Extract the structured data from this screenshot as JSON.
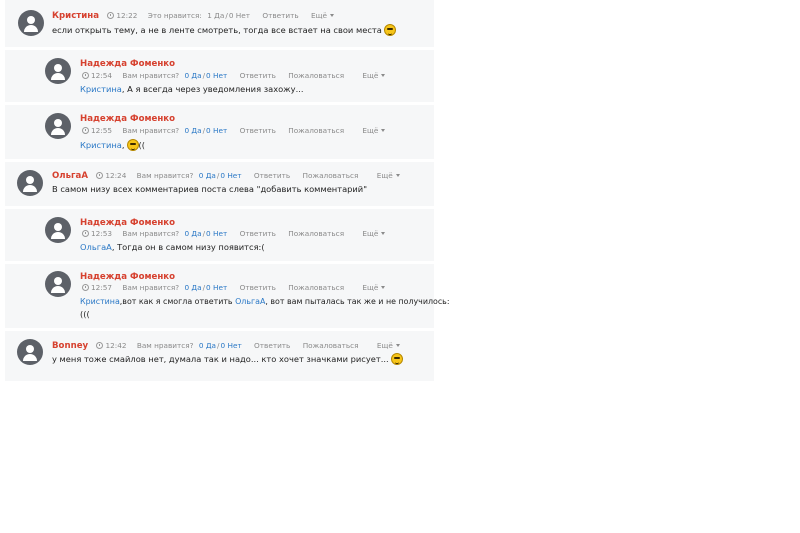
{
  "labels": {
    "like_question": "Вам нравится?",
    "like_question_alt": "Это нравится:",
    "yes": "1 Да",
    "no": "0 Нет",
    "yes0": "0 Да",
    "reply": "Ответить",
    "report": "Пожаловаться",
    "more": "Ещё"
  },
  "comments": [
    {
      "author": "Кристина",
      "time": "12:22",
      "text": "если открыть тему, а не в ленте смотреть, тогда все встает на свои места"
    },
    {
      "author": "Надежда Фоменко",
      "time": "12:54",
      "mention": "Кристина",
      "text": ", А я всегда через уведомления захожу..."
    },
    {
      "author": "Надежда Фоменко",
      "time": "12:55",
      "mention": "Кристина",
      "text_before_smiley": ",",
      "text": "(("
    },
    {
      "author": "ОльгаА",
      "time": "12:24",
      "text": "В самом низу всех комментариев поста слева \"добавить комментарий\""
    },
    {
      "author": "Надежда Фоменко",
      "time": "12:53",
      "mention": "ОльгаА",
      "text": ", Тогда он в самом низу появится:("
    },
    {
      "author": "Надежда Фоменко",
      "time": "12:57",
      "mention": "Кристина",
      "text": ",вот как я смогла ответить",
      "mention2": "ОльгаА",
      "text2": ", вот вам пыталась так же и не получилось:",
      "text3": "((("
    },
    {
      "author": "Bonney",
      "time": "12:42",
      "text": "у меня тоже смайлов нет, думала так и надо... кто хочет значками рисует..."
    }
  ]
}
